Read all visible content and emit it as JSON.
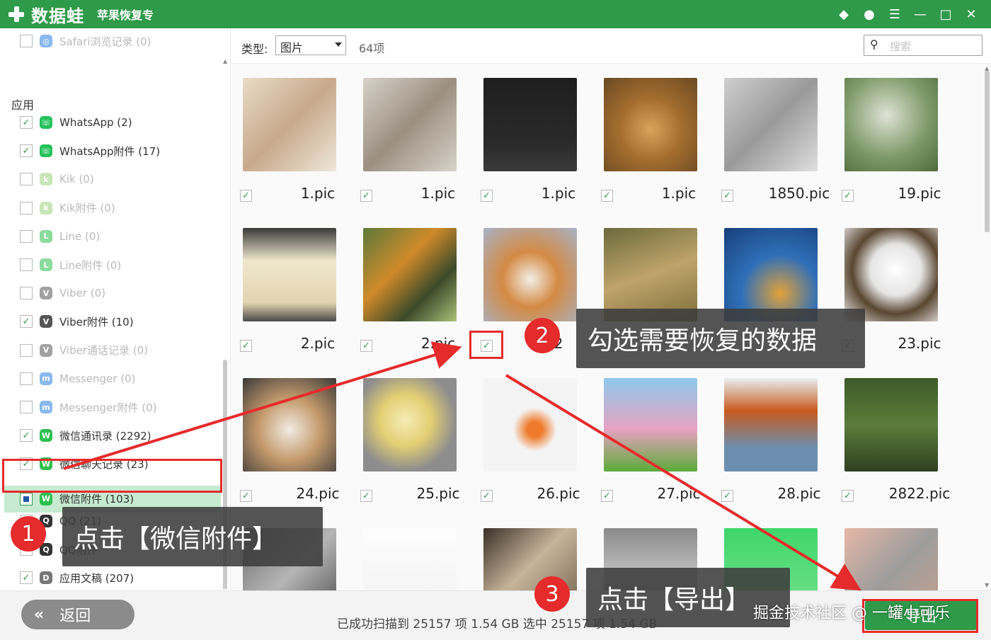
{
  "titlebar": {
    "brand": "数据蛙",
    "subtitle": "苹果恢复专",
    "icons": [
      "diamond-icon",
      "chat-icon",
      "menu-icon",
      "minimize-icon",
      "maximize-icon",
      "close-icon"
    ]
  },
  "sidebar": {
    "top_item": {
      "label": "Safari浏览记录 (0)",
      "checked": false
    },
    "section": "应用",
    "items": [
      {
        "label": "WhatsApp (2)",
        "checked": true,
        "dim": false,
        "icon": "whatsapp-icon",
        "color": "#25c25a",
        "glyph": "☏"
      },
      {
        "label": "WhatsApp附件 (17)",
        "checked": true,
        "dim": false,
        "icon": "whatsapp-attachment-icon",
        "color": "#25c25a",
        "glyph": "☏"
      },
      {
        "label": "Kik (0)",
        "checked": false,
        "dim": true,
        "icon": "kik-icon",
        "color": "#9bd27a",
        "glyph": "k"
      },
      {
        "label": "Kik附件 (0)",
        "checked": false,
        "dim": true,
        "icon": "kik-attachment-icon",
        "color": "#9bd27a",
        "glyph": "k"
      },
      {
        "label": "Line (0)",
        "checked": false,
        "dim": true,
        "icon": "line-icon",
        "color": "#2fbf4f",
        "glyph": "L"
      },
      {
        "label": "Line附件 (0)",
        "checked": false,
        "dim": true,
        "icon": "line-attachment-icon",
        "color": "#2fbf4f",
        "glyph": "L"
      },
      {
        "label": "Viber (0)",
        "checked": false,
        "dim": true,
        "icon": "viber-icon",
        "color": "#555555",
        "glyph": "V"
      },
      {
        "label": "Viber附件 (10)",
        "checked": true,
        "dim": false,
        "icon": "viber-attachment-icon",
        "color": "#555555",
        "glyph": "V"
      },
      {
        "label": "Viber通话记录 (0)",
        "checked": false,
        "dim": true,
        "icon": "viber-calls-icon",
        "color": "#555555",
        "glyph": "V"
      },
      {
        "label": "Messenger (0)",
        "checked": false,
        "dim": true,
        "icon": "messenger-icon",
        "color": "#2a7fe0",
        "glyph": "m"
      },
      {
        "label": "Messenger附件 (0)",
        "checked": false,
        "dim": true,
        "icon": "messenger-attachment-icon",
        "color": "#2a7fe0",
        "glyph": "m"
      },
      {
        "label": "微信通讯录 (2292)",
        "checked": true,
        "dim": false,
        "icon": "wechat-contacts-icon",
        "color": "#2fbf4f",
        "glyph": "W"
      },
      {
        "label": "微信聊天记录 (23)",
        "checked": true,
        "dim": false,
        "icon": "wechat-chat-icon",
        "color": "#2fbf4f",
        "glyph": "W"
      },
      {
        "label": "微信附件 (103)",
        "checked": true,
        "dim": false,
        "selected": true,
        "icon": "wechat-attachment-icon",
        "color": "#2fbf4f",
        "glyph": "W"
      },
      {
        "label": "QQ (21)",
        "checked": true,
        "dim": false,
        "icon": "qq-icon",
        "color": "#333333",
        "glyph": "Q"
      },
      {
        "label": "QQ附件",
        "checked": true,
        "dim": false,
        "icon": "qq-attachment-icon",
        "color": "#333333",
        "glyph": "Q"
      },
      {
        "label": "应用文稿 (207)",
        "checked": true,
        "dim": false,
        "icon": "app-docs-icon",
        "color": "#777777",
        "glyph": "D"
      }
    ]
  },
  "toolbar": {
    "type_label": "类型:",
    "type_value": "图片",
    "count": "64项",
    "search_placeholder": "搜索"
  },
  "grid": {
    "rows": [
      [
        {
          "name": "1.pic",
          "checked": true,
          "bg": "linear-gradient(135deg,#e9dcc8,#c8a98a 50%,#efe7da)"
        },
        {
          "name": "1.pic",
          "checked": true,
          "bg": "linear-gradient(135deg,#d8d2c8,#9c8f82 50%,#d9d3c9)"
        },
        {
          "name": "1.pic",
          "checked": true,
          "bg": "linear-gradient(180deg,#1e1e1e,#2a2a2a 70%,#3b3b3b)"
        },
        {
          "name": "1.pic",
          "checked": true,
          "bg": "radial-gradient(circle at 50% 55%,#d9a35b,#a46d2f 45%,#6a4a22)"
        },
        {
          "name": "1850.pic",
          "checked": true,
          "bg": "linear-gradient(135deg,#cfcfcf,#9a9a9a 50%,#e0e0e0)"
        },
        {
          "name": "19.pic",
          "checked": true,
          "bg": "radial-gradient(circle at 45% 40%,#dfe3d5,#7f9a6a 55%,#4e6b3a)"
        }
      ],
      [
        {
          "name": "2.pic",
          "checked": true,
          "bg": "linear-gradient(180deg,#3a3a3a,#efe7cc 35%,#e2d4b0 80%,#4a4a4a)"
        },
        {
          "name": "2.pic",
          "checked": true,
          "bg": "linear-gradient(135deg,#5d7a3a,#cf8a2a 40%,#3c4a2a 70%,#a9c27a)"
        },
        {
          "name": "2",
          "checked": true,
          "bg": "radial-gradient(circle at 50% 55%,#f3efe8,#d48a44 40%,#a7b3c7)"
        },
        {
          "name": "",
          "checked": true,
          "bg": "linear-gradient(160deg,#6c6a3c,#bfa46a 50%,#7d6d3a)"
        },
        {
          "name": "",
          "checked": true,
          "bg": "radial-gradient(circle at 60% 70%,#e2a23a,#2f6fb8 45%,#173f7a)"
        },
        {
          "name": "23.pic",
          "checked": true,
          "bg": "radial-gradient(circle at 55% 45%,#ffffff,#e5e5e5 35%,#5a4630 60%,#f0f0f0)"
        }
      ],
      [
        {
          "name": "24.pic",
          "checked": true,
          "bg": "radial-gradient(circle at 50% 55%,#f1ece4,#c49a6c 45%,#3a3a3a)"
        },
        {
          "name": "25.pic",
          "checked": true,
          "bg": "radial-gradient(circle at 45% 45%,#f6ecb8,#e4cf74 35%,#8d8d8d 70%)"
        },
        {
          "name": "26.pic",
          "checked": true,
          "bg": "radial-gradient(circle at 55% 55%,#ee7a2a 10%,#f4f4f4 30%)"
        },
        {
          "name": "27.pic",
          "checked": true,
          "bg": "linear-gradient(180deg,#8ec9ec,#e6a2c0 55%,#5cab3a)"
        },
        {
          "name": "28.pic",
          "checked": true,
          "bg": "linear-gradient(180deg,#e9f0f3,#c75a1e 35%,#6c8fb0 75%)"
        },
        {
          "name": "2822.pic",
          "checked": true,
          "bg": "linear-gradient(180deg,#3d5a2a,#5b7c3a 50%,#2e4020)"
        }
      ],
      [
        {
          "name": "",
          "checked": false,
          "bg": "linear-gradient(135deg,#6c6c6c,#b5b5b5 50%,#4e4e4e)"
        },
        {
          "name": "",
          "checked": false,
          "bg": "linear-gradient(180deg,#fdfdfd,#f1f1f1)"
        },
        {
          "name": "",
          "checked": false,
          "bg": "linear-gradient(135deg,#3a3028,#c7b49a 45%,#6a5a48)"
        },
        {
          "name": "",
          "checked": false,
          "bg": "linear-gradient(180deg,#8a8a8a,#c6c6c6 55%,#6e6e6e)"
        },
        {
          "name": "",
          "checked": false,
          "bg": "linear-gradient(180deg,#3fd66a,#79e28f)"
        },
        {
          "name": "",
          "checked": false,
          "bg": "linear-gradient(135deg,#e6b8a6,#9d9d9d 50%,#c9a18c)"
        }
      ]
    ]
  },
  "bottom": {
    "back_label": "返回",
    "status": "已成功扫描到 25157 项 1.54 GB  选中 25157 项 1.54 GB",
    "export_label": "导出"
  },
  "annotations": {
    "step1": {
      "num": "1",
      "text": "点击【微信附件】"
    },
    "step2": {
      "num": "2",
      "text": "勾选需要恢复的数据"
    },
    "step3": {
      "num": "3",
      "text": "点击【导出】"
    },
    "watermark": "掘金技术社区 @ 一罐小可乐"
  },
  "colors": {
    "accent": "#2f9a4a",
    "highlight": "#e52b2b"
  }
}
